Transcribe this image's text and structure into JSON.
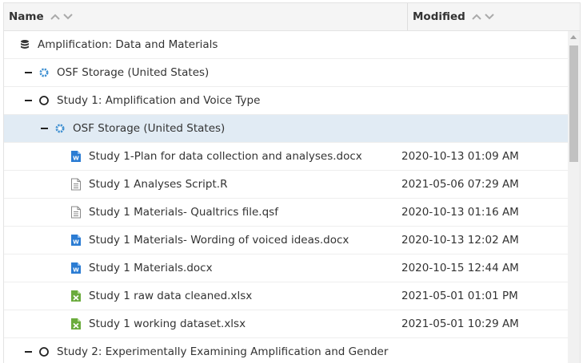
{
  "header": {
    "name_label": "Name",
    "modified_label": "Modified",
    "sort_up_icon": "caret-up",
    "sort_down_icon": "caret-down"
  },
  "rows": [
    {
      "label": "Amplification: Data and Materials",
      "icon": "database-icon",
      "modified": ""
    },
    {
      "label": "OSF Storage (United States)",
      "icon": "osf-storage-icon",
      "modified": ""
    },
    {
      "label": "Study 1: Amplification and Voice Type",
      "icon": "component-circle-icon",
      "modified": ""
    },
    {
      "label": "OSF Storage (United States)",
      "icon": "osf-storage-icon",
      "modified": "",
      "selected": true
    },
    {
      "label": "Study 1-Plan for data collection and analyses.docx",
      "icon": "word-file-icon",
      "modified": "2020-10-13 01:09 AM"
    },
    {
      "label": "Study 1 Analyses Script.R",
      "icon": "text-file-icon",
      "modified": "2021-05-06 07:29 AM"
    },
    {
      "label": "Study 1 Materials- Qualtrics file.qsf",
      "icon": "text-file-icon",
      "modified": "2020-10-13 01:16 AM"
    },
    {
      "label": "Study 1 Materials- Wording of voiced ideas.docx",
      "icon": "word-file-icon",
      "modified": "2020-10-13 12:02 AM"
    },
    {
      "label": "Study 1 Materials.docx",
      "icon": "word-file-icon",
      "modified": "2020-10-15 12:44 AM"
    },
    {
      "label": "Study 1 raw data cleaned.xlsx",
      "icon": "excel-file-icon",
      "modified": "2021-05-01 01:01 PM"
    },
    {
      "label": "Study 1 working dataset.xlsx",
      "icon": "excel-file-icon",
      "modified": "2021-05-01 10:29 AM"
    },
    {
      "label": "Study 2: Experimentally Examining Amplification and Gender",
      "icon": "component-circle-icon",
      "modified": ""
    }
  ],
  "colors": {
    "selected_row": "#e1ebf4",
    "word_icon": "#2b7cd3",
    "excel_icon": "#6aab3c",
    "osf_icon": "#3d8fd1"
  }
}
